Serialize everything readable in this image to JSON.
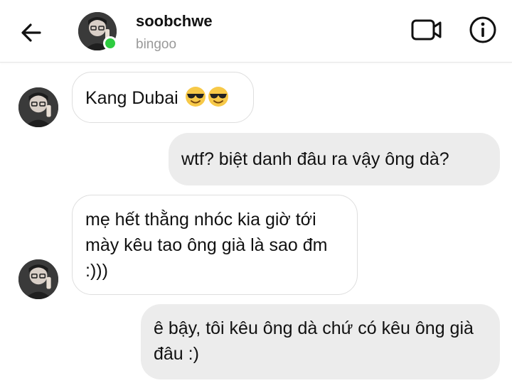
{
  "header": {
    "username": "soobchwe",
    "subtitle": "bingoo",
    "status": "online",
    "icons": [
      "back-arrow-icon",
      "video-call-icon",
      "info-icon"
    ]
  },
  "messages": [
    {
      "sender": "them",
      "text": "Kang Dubai",
      "emoji": [
        "smiling-face-with-sunglasses",
        "smiling-face-with-sunglasses"
      ]
    },
    {
      "sender": "me",
      "text": "wtf? biệt danh đâu ra vậy ông dà?"
    },
    {
      "sender": "them",
      "text": "mẹ hết thằng nhóc kia giờ tới mày kêu tao ông già là sao đm :)))"
    },
    {
      "sender": "me",
      "text": "ê bậy, tôi kêu ông dà chứ có kêu ông già đâu :)"
    }
  ],
  "colors": {
    "online": "#2ecc40",
    "outgoing_bubble": "#ececec",
    "incoming_border": "#dedede"
  }
}
